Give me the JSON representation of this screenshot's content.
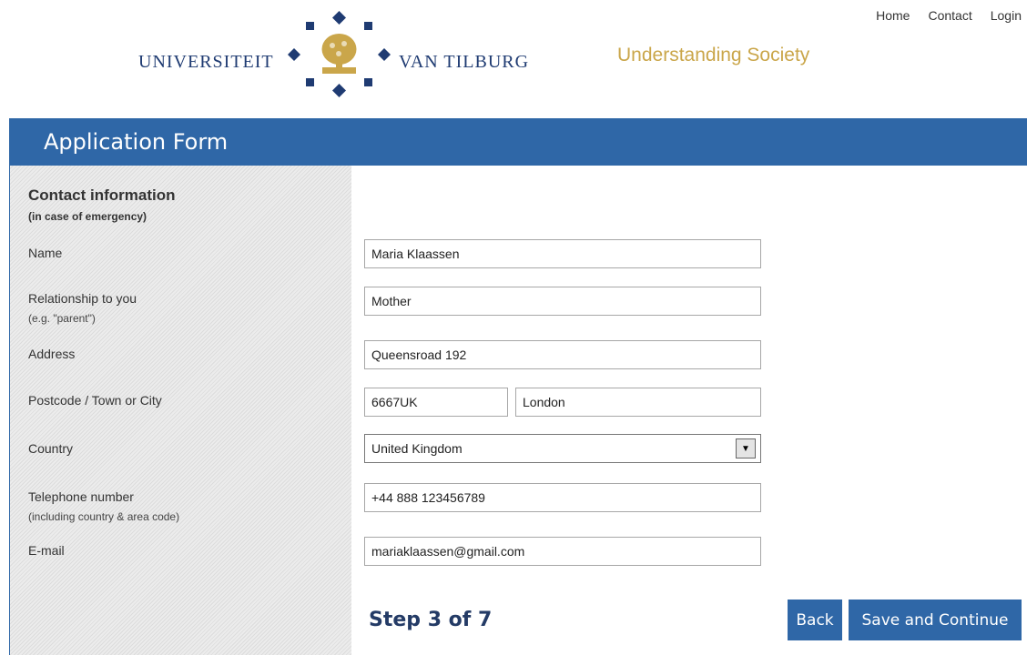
{
  "nav": {
    "home": "Home",
    "contact": "Contact",
    "login": "Login"
  },
  "logo": {
    "left_word": "UNIVERSITEIT",
    "right_word": "VAN TILBURG",
    "tagline": "Understanding Society"
  },
  "banner": {
    "title": "Application Form"
  },
  "section": {
    "title": "Contact information",
    "subtitle": "(in case of emergency)"
  },
  "fields": {
    "name": {
      "label": "Name",
      "value": "Maria Klaassen"
    },
    "relationship": {
      "label": "Relationship to you",
      "hint": "(e.g. \"parent\")",
      "value": "Mother"
    },
    "address": {
      "label": "Address",
      "value": "Queensroad 192"
    },
    "postcode_city": {
      "label": "Postcode / Town or City",
      "postcode": "6667UK",
      "city": "London"
    },
    "country": {
      "label": "Country",
      "value": "United Kingdom"
    },
    "telephone": {
      "label": "Telephone number",
      "hint": "(including country & area code)",
      "value": "+44 888 123456789"
    },
    "email": {
      "label": "E-mail",
      "value": "mariaklaassen@gmail.com"
    }
  },
  "footer": {
    "step": "Step 3 of 7",
    "back": "Back",
    "save": "Save and Continue"
  },
  "colors": {
    "banner": "#2f67a7",
    "tagline": "#caa64a",
    "logo_text": "#1f3b72",
    "step": "#243b66"
  }
}
